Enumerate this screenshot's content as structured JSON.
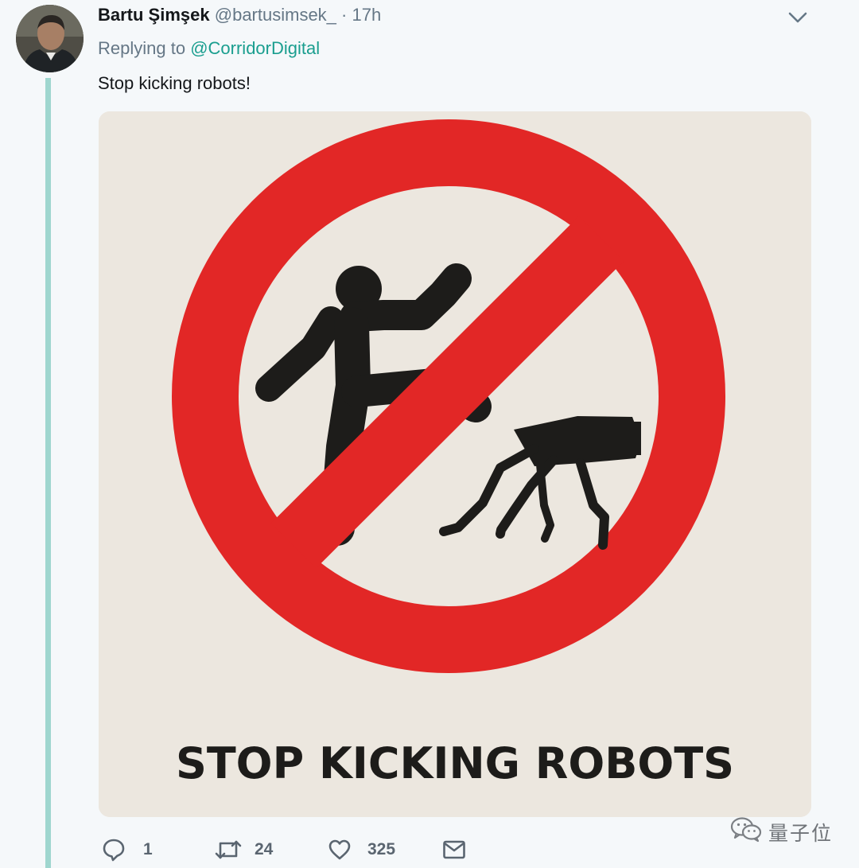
{
  "tweet": {
    "author": {
      "display_name": "Bartu Şimşek",
      "handle": "@bartusimsek_",
      "separator": "·",
      "time": "17h"
    },
    "reply": {
      "prefix": "Replying to",
      "mention": "@CorridorDigital"
    },
    "text": "Stop kicking robots!",
    "media": {
      "caption": "STOP KICKING ROBOTS",
      "colors": {
        "sign_red": "#e22726",
        "paper": "#ece7df",
        "ink": "#1d1c1a"
      }
    },
    "actions": {
      "reply": {
        "icon": "reply-icon",
        "count": "1"
      },
      "retweet": {
        "icon": "retweet-icon",
        "count": "24"
      },
      "like": {
        "icon": "heart-icon",
        "count": "325"
      },
      "message": {
        "icon": "envelope-icon"
      }
    },
    "menu_icon": "chevron-down-icon"
  },
  "watermark": {
    "icon": "wechat-icon",
    "text": "量子位"
  }
}
